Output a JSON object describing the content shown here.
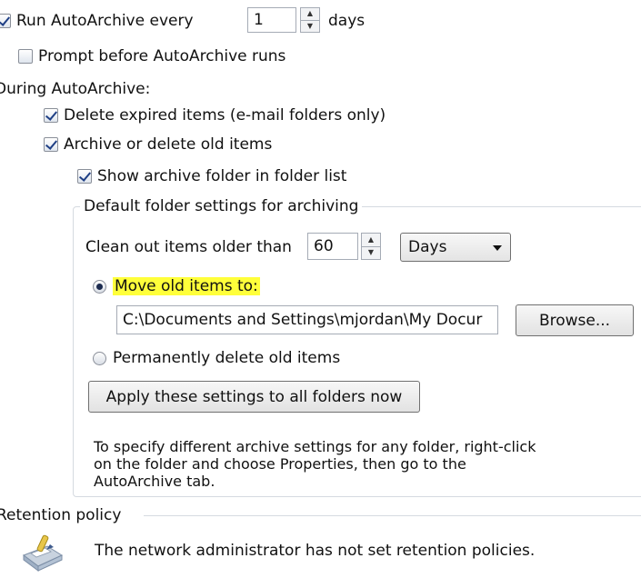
{
  "autoarchive": {
    "run_label": "Run AutoArchive every",
    "run_checked": true,
    "run_value": "1",
    "run_unit": "days",
    "prompt_label": "Prompt before AutoArchive runs",
    "prompt_checked": false
  },
  "during": {
    "heading": "During AutoArchive:",
    "delete_expired_label": "Delete expired items (e-mail folders only)",
    "delete_expired_checked": true,
    "archive_old_label": "Archive or delete old items",
    "archive_old_checked": true,
    "show_folder_label": "Show archive folder in folder list",
    "show_folder_checked": true
  },
  "defaults": {
    "group_title": "Default folder settings for archiving",
    "clean_label": "Clean out items older than",
    "clean_value": "60",
    "clean_unit_selected": "Days",
    "move_label": "Move old items to:",
    "move_selected": true,
    "path_value": "C:\\Documents and Settings\\mjordan\\My Docur",
    "browse_label": "Browse...",
    "perm_delete_label": "Permanently delete old items",
    "apply_label": "Apply these settings to all folders now"
  },
  "note": {
    "line1": "To specify different archive settings for any folder, right-click",
    "line2": "on the folder and choose Properties, then go to the",
    "line3": "AutoArchive tab."
  },
  "retention": {
    "heading": "Retention policy",
    "message": "The network administrator has not set retention policies."
  },
  "colors": {
    "highlight": "#ffff3a",
    "check": "#1f3f85"
  }
}
